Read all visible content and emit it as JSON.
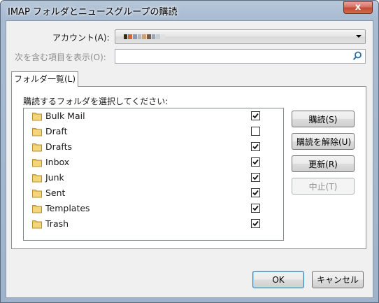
{
  "window": {
    "title": "IMAP フォルダとニュースグループの購読",
    "close_label": "x"
  },
  "account": {
    "label": "アカウント(A):",
    "selected_value_colors": [
      "#3a2a1a",
      "#c86a3a",
      "#8a9ab0",
      "#b0b8c4",
      "#d0a070",
      "#7a5a40",
      "#9aa6b8",
      "#c8ccd4",
      "#e0e0e0"
    ]
  },
  "filter": {
    "label": "次を含む項目を表示(O):",
    "value": "",
    "placeholder": ""
  },
  "tabs": [
    {
      "label": "フォルダ一覧(L)",
      "selected": true
    }
  ],
  "panel": {
    "instruction": "購読するフォルダを選択してください:",
    "folders": [
      {
        "name": "Bulk Mail",
        "subscribed": true
      },
      {
        "name": "Draft",
        "subscribed": false
      },
      {
        "name": "Drafts",
        "subscribed": true
      },
      {
        "name": "Inbox",
        "subscribed": true
      },
      {
        "name": "Junk",
        "subscribed": true
      },
      {
        "name": "Sent",
        "subscribed": true
      },
      {
        "name": "Templates",
        "subscribed": true
      },
      {
        "name": "Trash",
        "subscribed": true
      }
    ]
  },
  "side_buttons": {
    "subscribe": "購読(S)",
    "unsubscribe": "購読を解除(U)",
    "refresh": "更新(R)",
    "stop": "中止(T)"
  },
  "footer": {
    "ok": "OK",
    "cancel": "キャンセル"
  },
  "colors": {
    "folder_icon": "#e8c25a",
    "accent_border": "#3c7fb1"
  }
}
